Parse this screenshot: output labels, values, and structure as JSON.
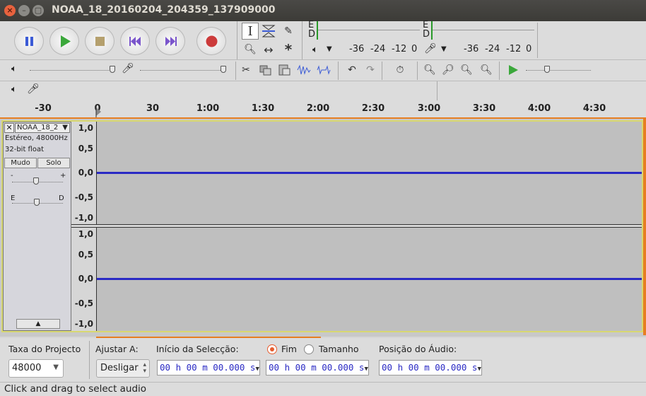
{
  "window": {
    "title": "NOAA_18_20160204_204359_137909000",
    "close": "×",
    "minimize": "–",
    "maximize": "▢"
  },
  "meters": {
    "rec_E": "E",
    "rec_D": "D",
    "play_E": "E",
    "play_D": "D",
    "ticks": [
      "-36",
      "-24",
      "-12",
      "0"
    ]
  },
  "ruler": {
    "labels": [
      "-30",
      "0",
      "30",
      "1:00",
      "1:30",
      "2:00",
      "2:30",
      "3:00",
      "3:30",
      "4:00",
      "4:30"
    ]
  },
  "track": {
    "name": "NOAA_18_2",
    "info1": "Estéreo, 48000Hz",
    "info2": "32-bit float",
    "mute": "Mudo",
    "solo": "Solo",
    "gain_minus": "-",
    "gain_plus": "+",
    "pan_left": "E",
    "pan_right": "D",
    "scale_top": [
      "1,0",
      "0,5",
      "0,0",
      "-0,5",
      "-1,0"
    ],
    "scale_bottom": [
      "1,0",
      "0,5",
      "0,0",
      "-0,5",
      "-1,0"
    ]
  },
  "selection_bar": {
    "rate_label": "Taxa do Projecto",
    "rate_value": "48000",
    "snap_label": "Ajustar A:",
    "snap_value": "Desligar",
    "start_label": "Início da Selecção:",
    "end_label": "Fim",
    "length_label": "Tamanho",
    "position_label": "Posição do Áudio:",
    "start_time": "00 h 00 m 00.000 s",
    "end_time": "00 h 00 m 00.000 s",
    "position_time": "00 h 00 m 00.000 s"
  },
  "status": "Click and drag to select audio"
}
